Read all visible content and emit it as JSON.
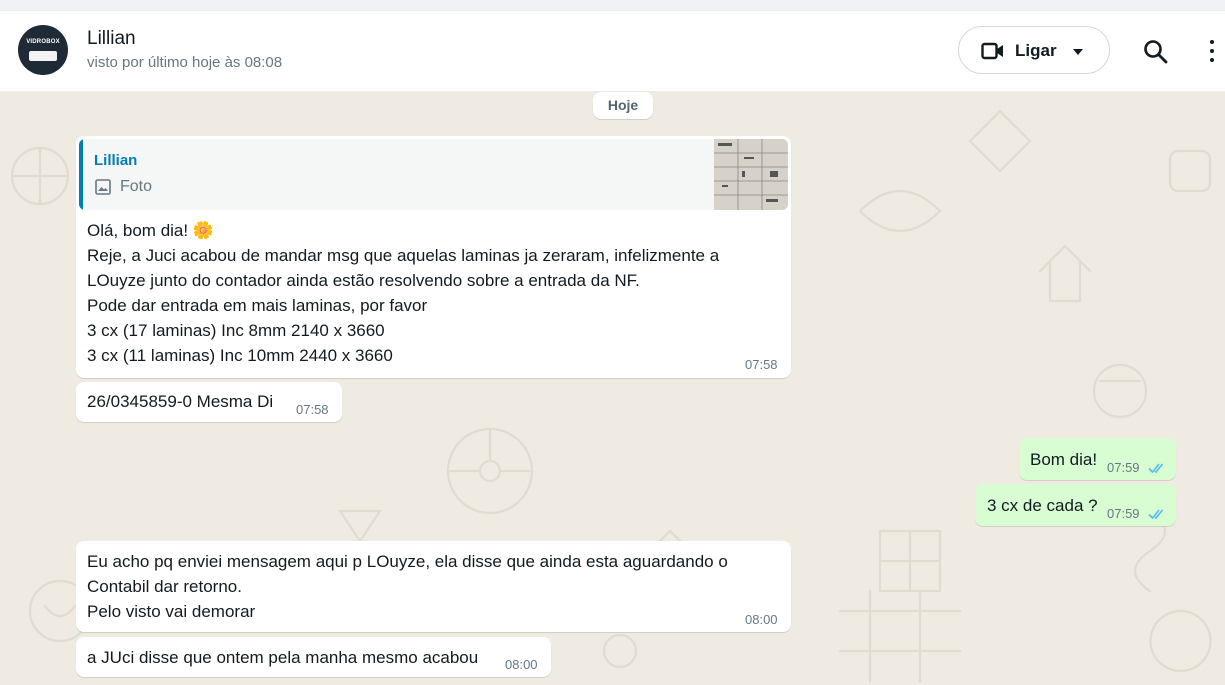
{
  "header": {
    "contact_name": "Lillian",
    "last_seen": "visto por último hoje às 08:08",
    "avatar_text": "VIDROBOX",
    "call_label": "Ligar"
  },
  "day_chip": "Hoje",
  "messages": [
    {
      "direction": "in",
      "quote": {
        "author": "Lillian",
        "type": "Foto"
      },
      "lines": [
        "Olá, bom dia! 🌼",
        "Reje, a Juci acabou de mandar msg que aquelas laminas ja zeraram, infelizmente a",
        "LOuyze junto do contador ainda estão resolvendo sobre a entrada da NF.",
        "Pode dar entrada em mais laminas, por favor",
        "3 cx (17 laminas) Inc 8mm 2140 x 3660",
        "3 cx (11 laminas) Inc 10mm 2440 x 3660"
      ],
      "time": "07:58"
    },
    {
      "direction": "in",
      "lines": [
        "26/0345859-0  Mesma Di"
      ],
      "time": "07:58"
    },
    {
      "direction": "out",
      "lines": [
        "Bom dia!"
      ],
      "time": "07:59",
      "status": "read"
    },
    {
      "direction": "out",
      "lines": [
        "3 cx de cada ?"
      ],
      "time": "07:59",
      "status": "read"
    },
    {
      "direction": "in",
      "lines": [
        "Eu acho pq enviei mensagem aqui p LOuyze, ela disse que ainda esta aguardando o",
        "Contabil dar retorno.",
        "Pelo visto vai demorar"
      ],
      "time": "08:00"
    },
    {
      "direction": "in",
      "lines": [
        "a JUci disse que ontem pela manha mesmo acabou"
      ],
      "time": "08:00"
    }
  ],
  "colors": {
    "wallpaper": "#efeae2",
    "incoming_bubble": "#ffffff",
    "outgoing_bubble": "#d9fdd3",
    "read_ticks": "#53bdeb",
    "quote_author": "#027eb5"
  },
  "icons": [
    "video-camera-icon",
    "chevron-down-icon",
    "search-icon",
    "kebab-menu-icon",
    "image-icon",
    "double-check-icon"
  ]
}
